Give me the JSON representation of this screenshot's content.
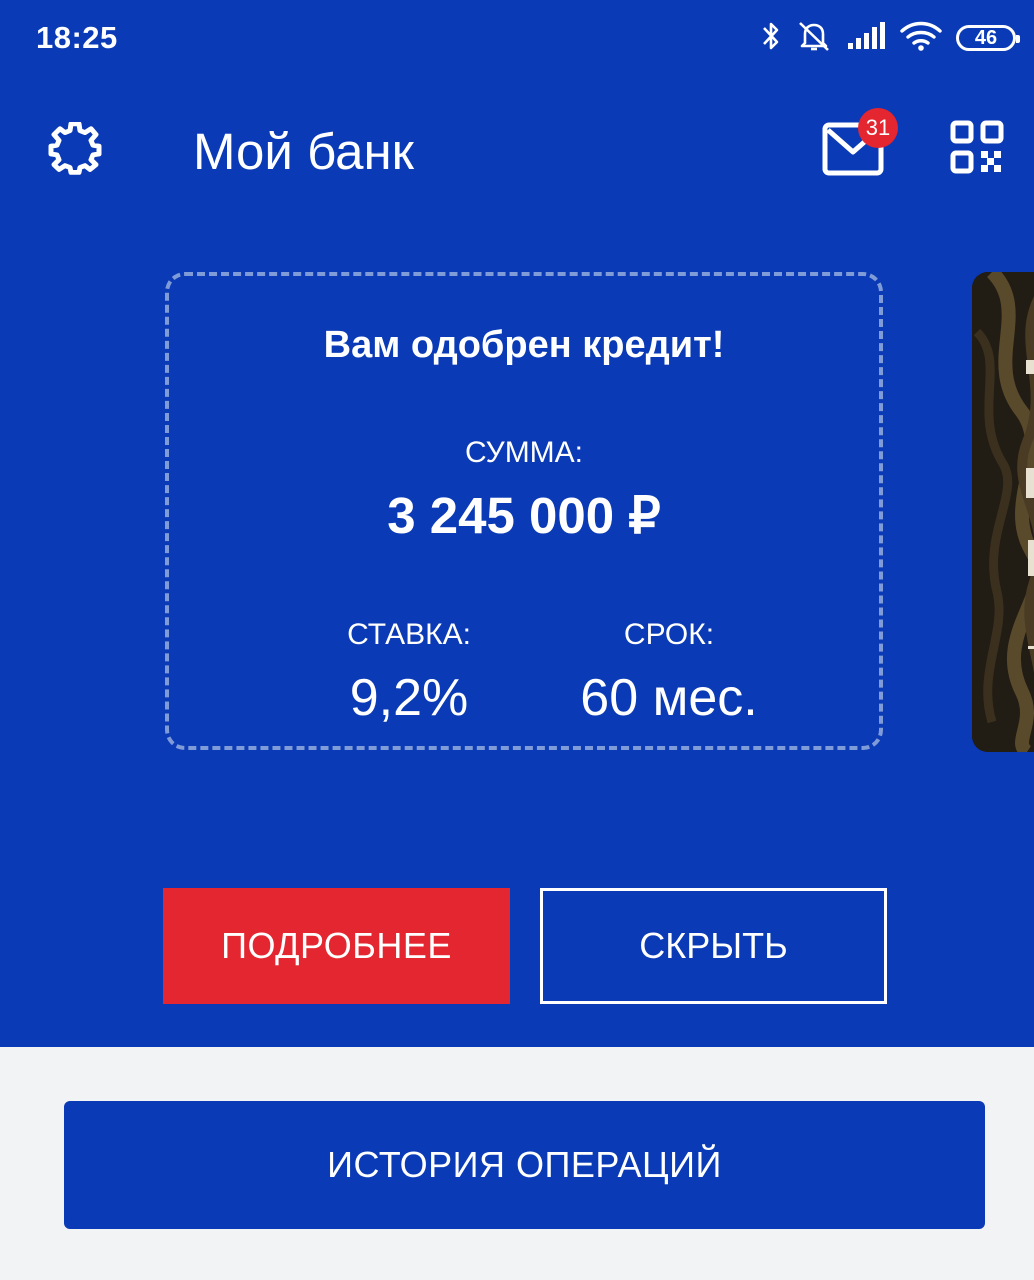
{
  "status_bar": {
    "time": "18:25",
    "battery": "46",
    "icons": [
      "bluetooth-icon",
      "mute-icon",
      "signal-icon",
      "wifi-icon",
      "battery-icon"
    ]
  },
  "header": {
    "title": "Мой банк",
    "notification_count": "31",
    "icons": [
      "gear-icon",
      "mail-icon",
      "qr-code-icon"
    ]
  },
  "offer": {
    "title": "Вам одобрен кредит!",
    "amount_label": "СУММА:",
    "amount_value": "3 245 000 ₽",
    "rate_label": "СТАВКА:",
    "rate_value": "9,2%",
    "term_label": "СРОК:",
    "term_value": "60 мес."
  },
  "actions": {
    "more_label": "ПОДРОБНЕЕ",
    "hide_label": "СКРЫТЬ",
    "history_label": "ИСТОРИЯ ОПЕРАЦИЙ"
  },
  "colors": {
    "primary_blue": "#0a3ab5",
    "accent_red": "#e3262f",
    "bottom_background": "#f2f3f5"
  }
}
